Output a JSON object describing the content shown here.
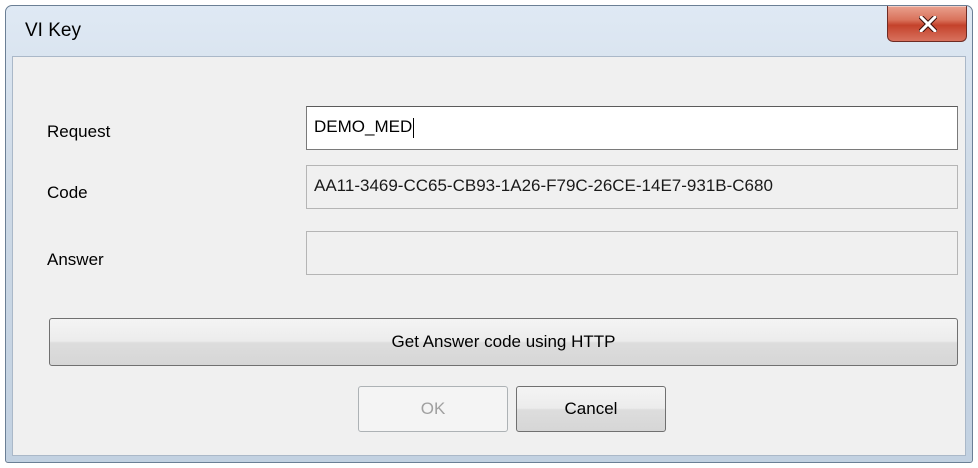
{
  "window": {
    "title": "VI Key",
    "close_glyph": "X",
    "close_icon": "close-icon"
  },
  "form": {
    "request": {
      "label": "Request",
      "value": "DEMO_MED"
    },
    "code": {
      "label": "Code",
      "value": "AA11-3469-CC65-CB93-1A26-F79C-26CE-14E7-931B-C680"
    },
    "answer": {
      "label": "Answer",
      "value": ""
    }
  },
  "buttons": {
    "get_answer": "Get Answer code using HTTP",
    "ok": "OK",
    "cancel": "Cancel"
  },
  "colors": {
    "close_button": "#c4422b",
    "dialog_background": "#f0f0f0",
    "title_frame": "#cdd9e6"
  }
}
